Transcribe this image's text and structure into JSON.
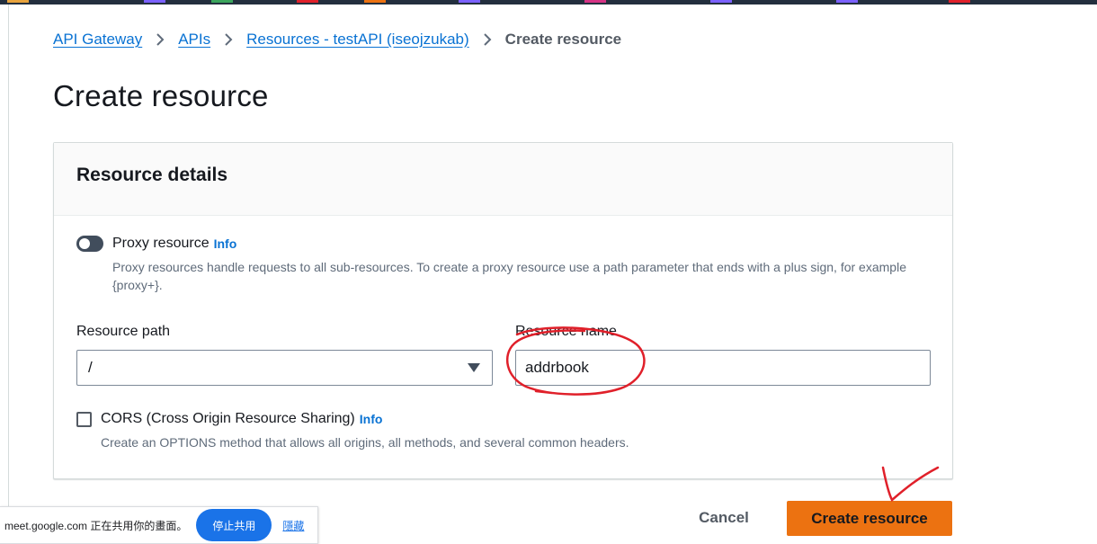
{
  "colors": {
    "link": "#0972d3",
    "primary_button": "#ec7211",
    "annotation_red": "#e0202a"
  },
  "breadcrumb": {
    "items": [
      "API Gateway",
      "APIs",
      "Resources - testAPI (iseojzukab)"
    ],
    "current": "Create resource"
  },
  "page": {
    "title": "Create resource"
  },
  "panel": {
    "title": "Resource details",
    "proxy": {
      "label": "Proxy resource",
      "info": "Info",
      "description": "Proxy resources handle requests to all sub-resources. To create a proxy resource use a path parameter that ends with a plus sign, for example {proxy+}.",
      "enabled": false
    },
    "resource_path": {
      "label": "Resource path",
      "value": "/"
    },
    "resource_name": {
      "label": "Resource name",
      "value": "addrbook"
    },
    "cors": {
      "label": "CORS (Cross Origin Resource Sharing)",
      "info": "Info",
      "description": "Create an OPTIONS method that allows all origins, all methods, and several common headers.",
      "checked": false
    }
  },
  "actions": {
    "cancel": "Cancel",
    "create": "Create resource"
  },
  "share_bar": {
    "text": "meet.google.com 正在共用你的畫面。",
    "stop": "停止共用",
    "hide": "隱藏"
  }
}
